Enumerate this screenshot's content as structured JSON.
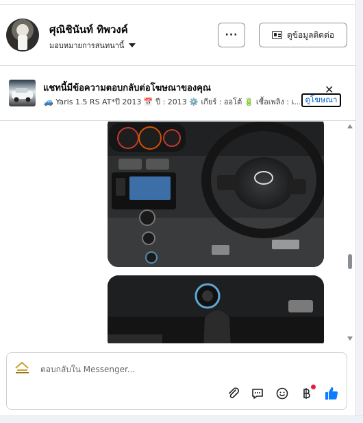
{
  "header": {
    "contact_name": "ศุณิชินันท์ ทิพวงค์",
    "assign_label": "มอบหมายการสนทนานี้",
    "more_label": "···",
    "contact_info_label": "ดูข้อมูลติดต่อ"
  },
  "ad_notice": {
    "title": "แชทนี้มีข้อความตอบกลับต่อโฆษณาของคุณ",
    "description": "🚙 Yaris 1.5 RS AT*ปี 2013 📅 ปี : 2013 ⚙️ เกียร์ : ออโต้ 🔋 เชื้อเพลิง : เ...",
    "view_ad_label": "ดูโฆษณา",
    "close_label": "✕"
  },
  "messages": {
    "items": [
      {
        "type": "photo",
        "subject": "car-dashboard-steering-wheel"
      },
      {
        "type": "photo",
        "subject": "car-gear-shifter"
      }
    ]
  },
  "composer": {
    "placeholder": "ตอบกลับใน Messenger...",
    "tools": [
      "paperclip-icon",
      "speech-bubble-icon",
      "emoji-icon",
      "baht-icon",
      "thumbs-up-icon"
    ]
  },
  "colors": {
    "link_blue": "#0064d1",
    "like_blue": "#0a7cff",
    "notification_red": "#e41e3f"
  }
}
